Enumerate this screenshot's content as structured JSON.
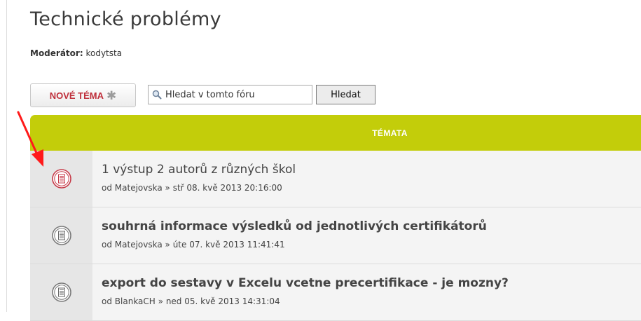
{
  "forum": {
    "title": "Technické problémy",
    "moderator_label": "Moderátor:",
    "moderator_name": "kodytsta"
  },
  "toolbar": {
    "new_topic_label": "NOVÉ TÉMA",
    "new_topic_icon": "star-icon",
    "search_placeholder": "Hledat v tomto fóru",
    "search_icon": "magnifier-icon",
    "search_button_label": "Hledat"
  },
  "topics": {
    "header": "TÉMATA",
    "rows": [
      {
        "title": "1 výstup 2 autorů z různých škol",
        "prefix": "od",
        "author": "Matejovska",
        "datetime": "» stř 08. kvě 2013 20:16:00",
        "icon": "topic-unread-icon"
      },
      {
        "title": "souhrná informace výsledků od jednotlivých certifikátorů",
        "prefix": "od",
        "author": "Matejovska",
        "datetime": "» úte 07. kvě 2013 11:41:41",
        "icon": "topic-read-icon"
      },
      {
        "title": "export do sestavy v Excelu vcetne precertifikace - je mozny?",
        "prefix": "od",
        "author": "BlankaCH",
        "datetime": "» ned 05. kvě 2013 14:31:04",
        "icon": "topic-read-icon"
      }
    ]
  },
  "colors": {
    "header_bg": "#c3cd0a",
    "accent_red": "#bf2f3b",
    "annotation_arrow": "#ff1a1a"
  }
}
